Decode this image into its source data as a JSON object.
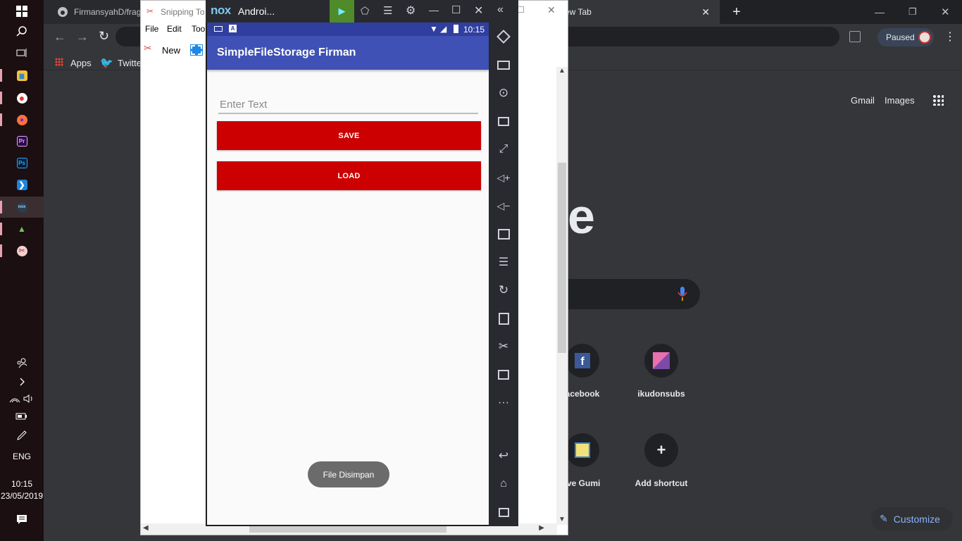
{
  "taskbar": {
    "apps": [
      {
        "icon": "file-explorer-icon",
        "color": "#f3c23c",
        "glyph": "▆"
      },
      {
        "icon": "chrome-icon",
        "color": "#e33b2e",
        "glyph": "●"
      },
      {
        "icon": "firefox-icon",
        "color": "#ff7139",
        "glyph": "●"
      },
      {
        "icon": "premiere-pro-icon",
        "color": "#2a0b4a",
        "glyph": "Pr"
      },
      {
        "icon": "photoshop-icon",
        "color": "#001d34",
        "glyph": "Ps"
      },
      {
        "icon": "vscode-icon",
        "color": "#1b86d8",
        "glyph": "❯"
      },
      {
        "icon": "nox-icon",
        "color": "#2b3d4f",
        "glyph": "nox"
      },
      {
        "icon": "android-studio-icon",
        "color": "#78c257",
        "glyph": "▲"
      },
      {
        "icon": "snipping-tool-icon",
        "color": "#d9534f",
        "glyph": "✂"
      }
    ],
    "language": "ENG",
    "clock_time": "10:15",
    "clock_date": "23/05/2019"
  },
  "chrome": {
    "tab1_title": "FirmansyahD/frag",
    "tab2_title": "ew Tab",
    "profile_status": "Paused",
    "bookmarks": {
      "apps_label": "Apps",
      "twitter_label": "Twitte"
    },
    "ntp": {
      "gmail": "Gmail",
      "images": "Images",
      "logo_fragment": "e",
      "shortcuts": [
        {
          "label": "acebook"
        },
        {
          "label": "ikudonsubs"
        },
        {
          "label": "ive Gumi"
        },
        {
          "label": "Add shortcut"
        }
      ],
      "customize": "Customize"
    }
  },
  "snipping_tool": {
    "title": "Snipping To",
    "menu": {
      "file": "File",
      "edit": "Edit",
      "tools": "Too"
    },
    "new_label": "New"
  },
  "nox": {
    "title": "Androi...",
    "logo": "nox",
    "status_time": "10:15",
    "app_title": "SimpleFileStorage Firman",
    "input_placeholder": "Enter Text",
    "input_value": "",
    "save_label": "SAVE",
    "load_label": "LOAD",
    "toast": "File Disimpan",
    "accent_color": "#3f51b5",
    "button_color": "#cc0000"
  }
}
